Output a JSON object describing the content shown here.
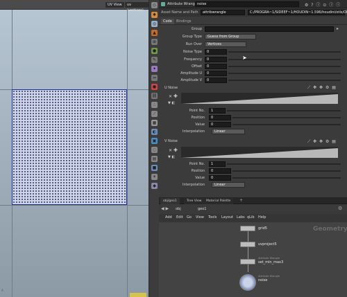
{
  "viewport": {
    "uv_view": "UV View",
    "uv_vertices": "uv (vertices)",
    "corner": "A"
  },
  "panel": {
    "node_type": "Attribute Wrangle",
    "node_name": "noise",
    "asset_label": "Asset Name and Path",
    "asset_name": "attribwrangle",
    "asset_path": "C:/PROGRA~1/SIDEEF~1/HOUDIN~1.596/houdini/otls/OPlib",
    "tabs": [
      "Code",
      "Bindings"
    ],
    "params": {
      "group": "Group",
      "group_type": "Group Type",
      "group_type_val": "Guess from Group",
      "run_over": "Run Over",
      "run_over_val": "Vertices",
      "noise_type": "Noise Type",
      "frequency": "Frequency",
      "offset": "Offset",
      "amp_u": "Amplitude U",
      "amp_v": "Amplitude V",
      "zero": "0"
    },
    "unoise": {
      "title": "U Noise",
      "point": "Point No.",
      "point_val": "1",
      "position": "Position",
      "value": "Value",
      "zero": "0",
      "interp": "Interpolation",
      "interp_val": "Linear"
    },
    "vnoise": {
      "title": "V Noise",
      "point": "Point No.",
      "point_val": "1",
      "position": "Position",
      "value": "Value",
      "zero": "0",
      "interp": "Interpolation",
      "interp_val": "Linear"
    }
  },
  "network": {
    "tabs": [
      "obj/geo1",
      "Tree View",
      "Material Palette"
    ],
    "path_obj": "obj",
    "path_geo": "geo1",
    "menu": [
      "Add",
      "Edit",
      "Go",
      "View",
      "Tools",
      "Layout",
      "Labs",
      "qLib",
      "Help"
    ],
    "context": "Geometry",
    "nodes": [
      {
        "name": "grid5",
        "type": ""
      },
      {
        "name": "uvproject5",
        "type": ""
      },
      {
        "name": "set_min_max3",
        "type": "Attribute Wrangle"
      },
      {
        "name": "noise",
        "type": "Attribute Wrangle"
      }
    ]
  }
}
